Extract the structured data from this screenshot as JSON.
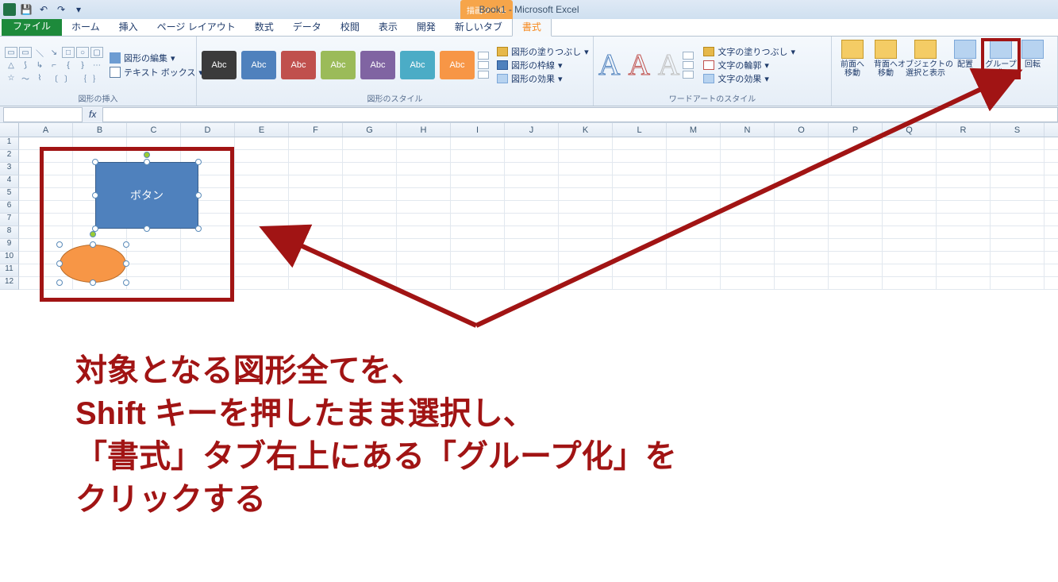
{
  "app_title": "Book1 - Microsoft Excel",
  "context_tab": "描画ツール",
  "tabs": {
    "file": "ファイル",
    "home": "ホーム",
    "insert": "挿入",
    "layout": "ページ レイアウト",
    "formulas": "数式",
    "data": "データ",
    "review": "校閲",
    "view": "表示",
    "dev": "開発",
    "newtab": "新しいタブ",
    "format": "書式"
  },
  "groups": {
    "insert_shapes": "図形の挿入",
    "shape_styles": "図形のスタイル",
    "wordart_styles": "ワードアートのスタイル"
  },
  "shape_side": {
    "edit": "図形の編集",
    "textbox": "テキスト ボックス"
  },
  "style_label": "Abc",
  "style_colors": [
    "#3b3b3b",
    "#4f81bd",
    "#c0504d",
    "#9bbb59",
    "#8064a2",
    "#4bacc6",
    "#f79646"
  ],
  "shape_menu": {
    "fill": "図形の塗りつぶし",
    "outline": "図形の枠線",
    "effects": "図形の効果"
  },
  "wa_menu": {
    "fill": "文字の塗りつぶし",
    "outline": "文字の輪郭",
    "effects": "文字の効果"
  },
  "arrange": {
    "front": "前面へ\n移動",
    "back": "背面へ\n移動",
    "selpane": "オブジェクトの\n選択と表示",
    "align": "配置",
    "group": "グループ化",
    "rotate": "回転"
  },
  "columns": [
    "A",
    "B",
    "C",
    "D",
    "E",
    "F",
    "G",
    "H",
    "I",
    "J",
    "K",
    "L",
    "M",
    "N",
    "O",
    "P",
    "Q",
    "R",
    "S"
  ],
  "rows": [
    "1",
    "2",
    "3",
    "4",
    "5",
    "6",
    "7",
    "8",
    "9",
    "10",
    "11",
    "12"
  ],
  "shape_button_text": "ボタン",
  "annotation_text": "対象となる図形全てを、\nShift キーを押したまま選択し、\n「書式」タブ右上にある「グループ化」を\nクリックする",
  "namebox_value": "",
  "formula_value": ""
}
